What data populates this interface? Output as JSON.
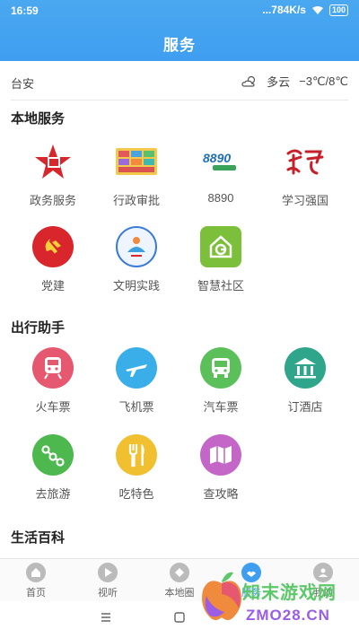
{
  "status_bar": {
    "time": "16:59",
    "network": "...784K/s",
    "battery": "100"
  },
  "header": {
    "title": "服务"
  },
  "weather": {
    "city": "台安",
    "condition": "多云",
    "temp": "−3℃/8℃"
  },
  "sections": {
    "local": {
      "title": "本地服务",
      "items": [
        "政务服务",
        "行政审批",
        "8890",
        "学习强国",
        "党建",
        "文明实践",
        "智慧社区"
      ]
    },
    "travel": {
      "title": "出行助手",
      "items": [
        "火车票",
        "飞机票",
        "汽车票",
        "订酒店",
        "去旅游",
        "吃特色",
        "查攻略"
      ]
    },
    "life": {
      "title": "生活百科"
    }
  },
  "tabbar": {
    "tabs": [
      "首页",
      "视听",
      "本地圈",
      "服务",
      "我的"
    ],
    "active": "服务"
  },
  "watermark": {
    "text1": "知末游戏网",
    "text2": "ZMO28.CN"
  },
  "colors": {
    "brand": "#3f9ef0",
    "train": "#e5586f",
    "plane": "#3aaee8",
    "bus": "#5cc05a",
    "hotel": "#2fa58c",
    "tour": "#4cb84e",
    "food": "#f0c030",
    "guide": "#c466c8"
  }
}
